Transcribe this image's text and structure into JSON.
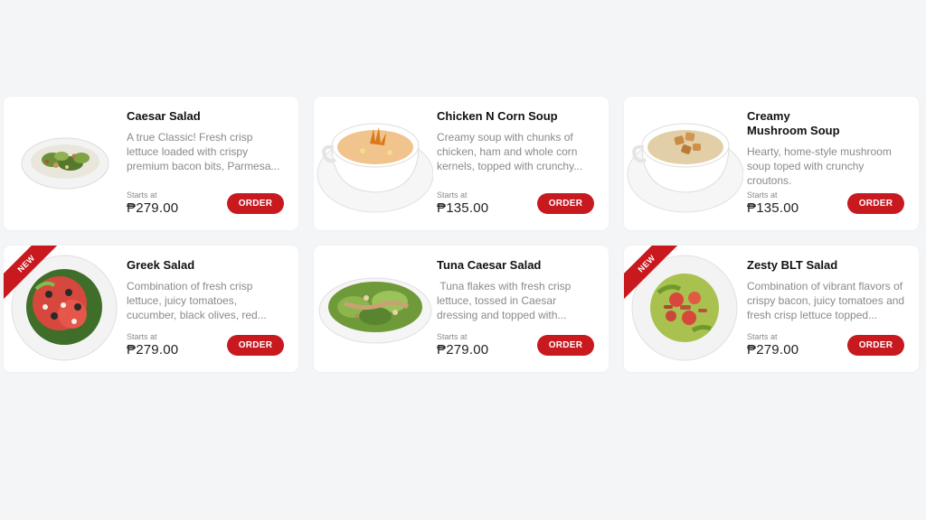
{
  "items": [
    {
      "name": "Caesar Salad",
      "description": "A true Classic! Fresh crisp lettuce loaded with crispy premium bacon bits, Parmesa...",
      "starts_label": "Starts at",
      "price": "₱279.00",
      "order_label": "ORDER",
      "image_icon": "caesar-salad-image"
    },
    {
      "name": "Chicken N Corn Soup",
      "description": "Creamy soup with chunks of chicken, ham and whole corn kernels, topped with crunchy...",
      "starts_label": "Starts at",
      "price": "₱135.00",
      "order_label": "ORDER",
      "image_icon": "corn-soup-image"
    },
    {
      "name": "Creamy Mushroom Soup",
      "description": "Hearty, home-style mushroom soup toped with crunchy croutons.",
      "starts_label": "Starts at",
      "price": "₱135.00",
      "order_label": "ORDER",
      "image_icon": "mushroom-soup-image"
    },
    {
      "name": "Greek Salad",
      "description": "Combination of fresh crisp lettuce, juicy tomatoes, cucumber, black olives, red...",
      "starts_label": "Starts at",
      "price": "₱279.00",
      "order_label": "ORDER",
      "badge": "NEW",
      "image_icon": "greek-salad-image"
    },
    {
      "name": "Tuna Caesar Salad",
      "description": " Tuna flakes with fresh crisp lettuce, tossed in Caesar dressing and topped with...",
      "starts_label": "Starts at",
      "price": "₱279.00",
      "order_label": "ORDER",
      "image_icon": "tuna-salad-image"
    },
    {
      "name": "Zesty BLT Salad",
      "description": "Combination of vibrant flavors of crispy bacon, juicy tomatoes and fresh crisp lettuce topped...",
      "starts_label": "Starts at",
      "price": "₱279.00",
      "order_label": "ORDER",
      "badge": "NEW",
      "image_icon": "blt-salad-image"
    }
  ],
  "colors": {
    "accent": "#c8191e",
    "background": "#f4f5f7",
    "card": "#ffffff",
    "muted_text": "#8a8a8a"
  }
}
